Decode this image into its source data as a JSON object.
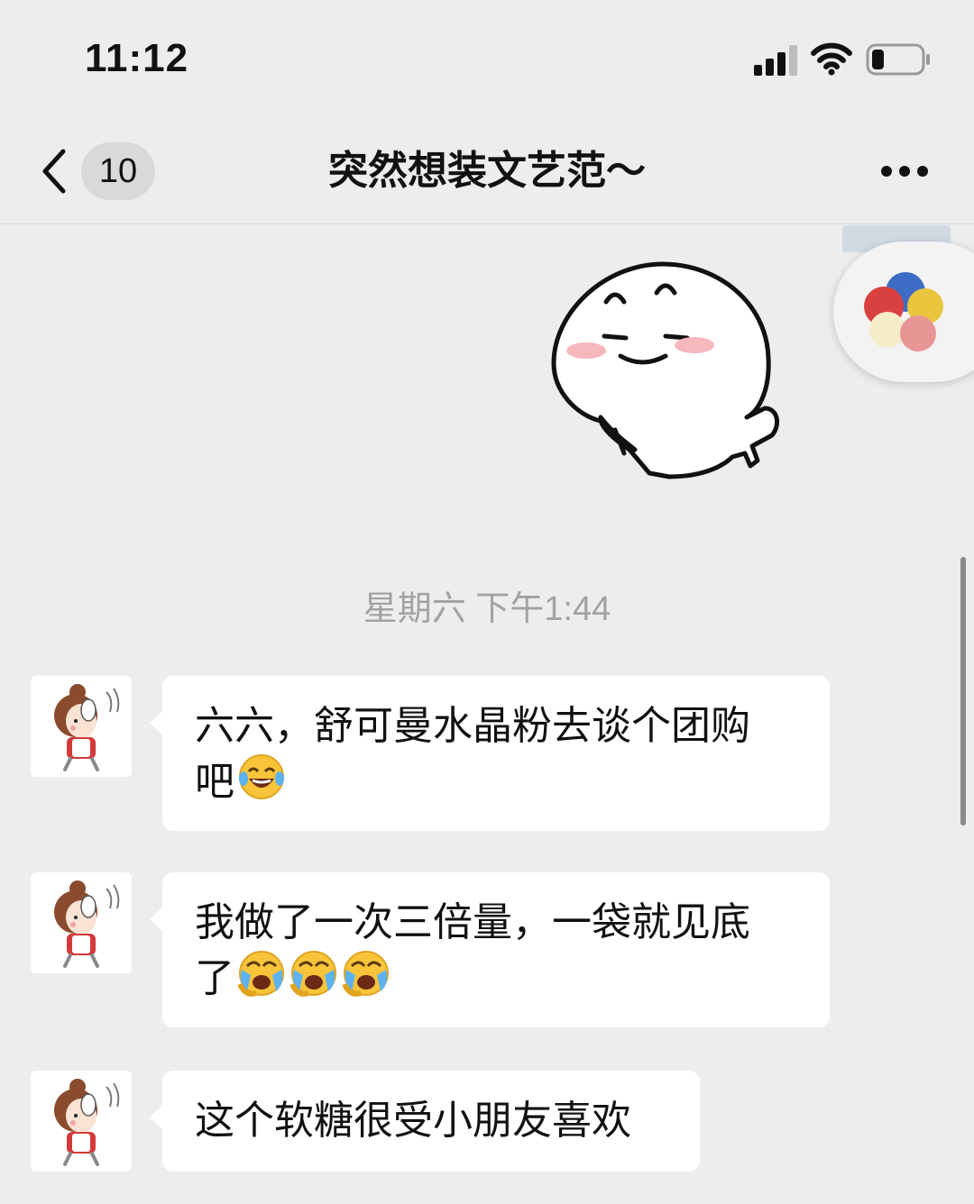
{
  "status_bar": {
    "time": "11:12",
    "signal_icon": "cellular-signal-icon",
    "wifi_icon": "wifi-icon",
    "battery_icon": "battery-low-icon",
    "battery_level": 0.25
  },
  "nav": {
    "back_icon": "chevron-left-icon",
    "unread_count": "10",
    "title": "突然想装文艺范～",
    "more_icon": "more-dots-icon"
  },
  "sticker": {
    "icon": "smiling-ghost-sticker"
  },
  "floating_widget": {
    "icon": "multicolor-circles-icon"
  },
  "timestamp": "星期六 下午1:44",
  "messages": [
    {
      "line1": "六六，舒可曼水晶粉去谈个团购",
      "line2": "吧",
      "emojis": [
        "tears-of-joy-emoji"
      ]
    },
    {
      "line1": "我做了一次三倍量，一袋就见底",
      "line2": "了",
      "emojis": [
        "crying-face-emoji",
        "crying-face-emoji",
        "crying-face-emoji"
      ]
    },
    {
      "line1": "这个软糖很受小朋友喜欢",
      "line2": "",
      "emojis": []
    }
  ],
  "colors": {
    "background": "#ededed",
    "bubble": "#ffffff",
    "timestamp": "#a2a2a2",
    "badge": "#d9d9d9"
  }
}
